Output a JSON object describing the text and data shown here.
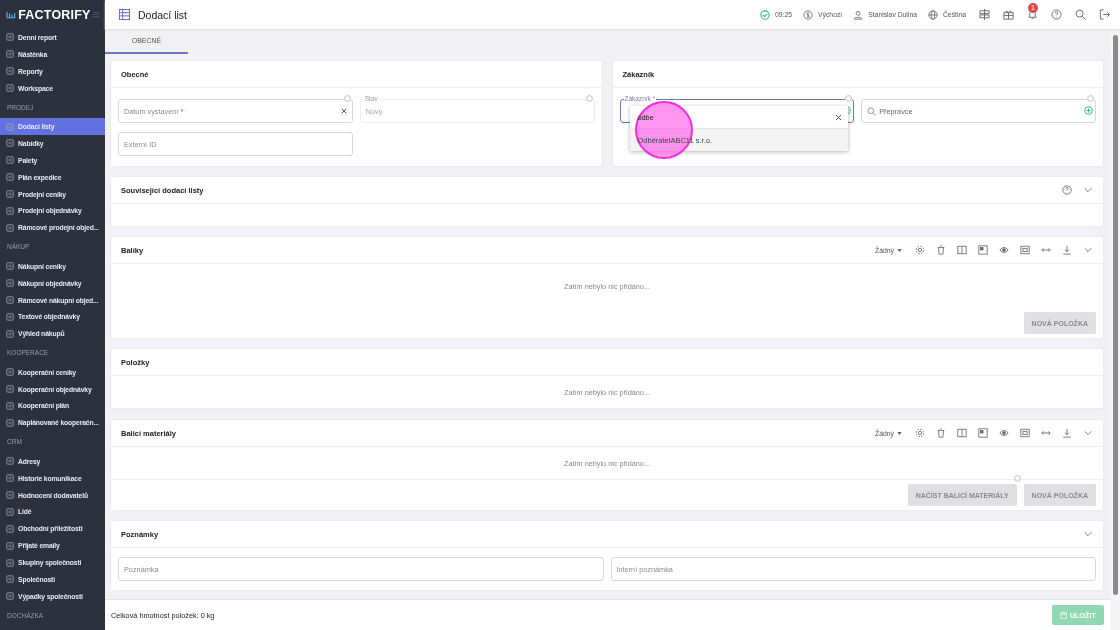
{
  "sidebar": {
    "logo": "FACTORIFY",
    "items": [
      {
        "kind": "item",
        "label": "Denní report",
        "selected": false
      },
      {
        "kind": "item",
        "label": "Nástěnka",
        "selected": false
      },
      {
        "kind": "item",
        "label": "Reporty",
        "selected": false
      },
      {
        "kind": "item",
        "label": "Workspace",
        "selected": false
      },
      {
        "kind": "section",
        "label": "PRODEJ"
      },
      {
        "kind": "item",
        "label": "Dodací listy",
        "selected": true
      },
      {
        "kind": "item",
        "label": "Nabídky",
        "selected": false
      },
      {
        "kind": "item",
        "label": "Palety",
        "selected": false
      },
      {
        "kind": "item",
        "label": "Plán expedice",
        "selected": false
      },
      {
        "kind": "item",
        "label": "Prodejní ceníky",
        "selected": false
      },
      {
        "kind": "item",
        "label": "Prodejní objednávky",
        "selected": false
      },
      {
        "kind": "item",
        "label": "Rámcové prodejní objed...",
        "selected": false
      },
      {
        "kind": "section",
        "label": "NÁKUP"
      },
      {
        "kind": "item",
        "label": "Nákupní ceníky",
        "selected": false
      },
      {
        "kind": "item",
        "label": "Nákupní objednávky",
        "selected": false
      },
      {
        "kind": "item",
        "label": "Rámcové nákupní objed...",
        "selected": false
      },
      {
        "kind": "item",
        "label": "Textové objednávky",
        "selected": false
      },
      {
        "kind": "item",
        "label": "Výhled nákupů",
        "selected": false
      },
      {
        "kind": "section",
        "label": "KOOPERACE"
      },
      {
        "kind": "item",
        "label": "Kooperační ceníky",
        "selected": false
      },
      {
        "kind": "item",
        "label": "Kooperační objednávky",
        "selected": false
      },
      {
        "kind": "item",
        "label": "Kooperační plán",
        "selected": false
      },
      {
        "kind": "item",
        "label": "Naplánované kooperačn...",
        "selected": false
      },
      {
        "kind": "section",
        "label": "CRM"
      },
      {
        "kind": "item",
        "label": "Adresy",
        "selected": false
      },
      {
        "kind": "item",
        "label": "Historie komunikace",
        "selected": false
      },
      {
        "kind": "item",
        "label": "Hodnocení dodavatelů",
        "selected": false
      },
      {
        "kind": "item",
        "label": "Lidé",
        "selected": false
      },
      {
        "kind": "item",
        "label": "Obchodní příležitosti",
        "selected": false
      },
      {
        "kind": "item",
        "label": "Přijaté emaily",
        "selected": false
      },
      {
        "kind": "item",
        "label": "Skupiny společností",
        "selected": false
      },
      {
        "kind": "item",
        "label": "Společnosti",
        "selected": false
      },
      {
        "kind": "item",
        "label": "Výpadky společností",
        "selected": false
      },
      {
        "kind": "section",
        "label": "DOCHÁZKA"
      }
    ]
  },
  "header": {
    "title": "Dodací list",
    "time": "09:25",
    "currency": "Výchozí",
    "user": "Stanislav Dulina",
    "language": "Čeština",
    "notifications": "1"
  },
  "tabs": [
    {
      "label": "OBECNÉ",
      "selected": true
    }
  ],
  "general": {
    "title": "Obecné",
    "date": {
      "placeholder": "Datum vystavení",
      "mark": "*"
    },
    "status": {
      "label": "Stav",
      "value": "Nový"
    },
    "external_id": {
      "placeholder": "Externí ID"
    }
  },
  "customer": {
    "title": "Zákazník",
    "field": {
      "label": "Zákazník",
      "mark": "*"
    },
    "search": "odbe",
    "options": [
      "OdběratelABC11 s.r.o."
    ],
    "carrier": {
      "placeholder": "Přepravce"
    }
  },
  "sections": [
    {
      "kind": "collapsible",
      "title": "Související dodací listy"
    },
    {
      "kind": "table",
      "title": "Balíky",
      "filter": "Žádný",
      "empty": "Zatím nebylo nic přidáno...",
      "buttons": [
        "NOVÁ POLOŽKA"
      ]
    },
    {
      "kind": "plain",
      "title": "Položky",
      "empty": "Zatím nebylo nic přidáno..."
    },
    {
      "kind": "table",
      "title": "Balicí materiály",
      "filter": "Žádný",
      "empty": "Zatím nebylo nic přidáno...",
      "buttons": [
        "NAČÍST BALICÍ MATERIÁLY",
        "NOVÁ POLOŽKA"
      ]
    }
  ],
  "notes": {
    "title": "Poznámky",
    "fields": [
      {
        "placeholder": "Poznámka"
      },
      {
        "placeholder": "Interní poznámka"
      }
    ]
  },
  "footer": {
    "weight": "Celková hmotnost položek: 0 kg",
    "save": "ULOŽIT"
  }
}
